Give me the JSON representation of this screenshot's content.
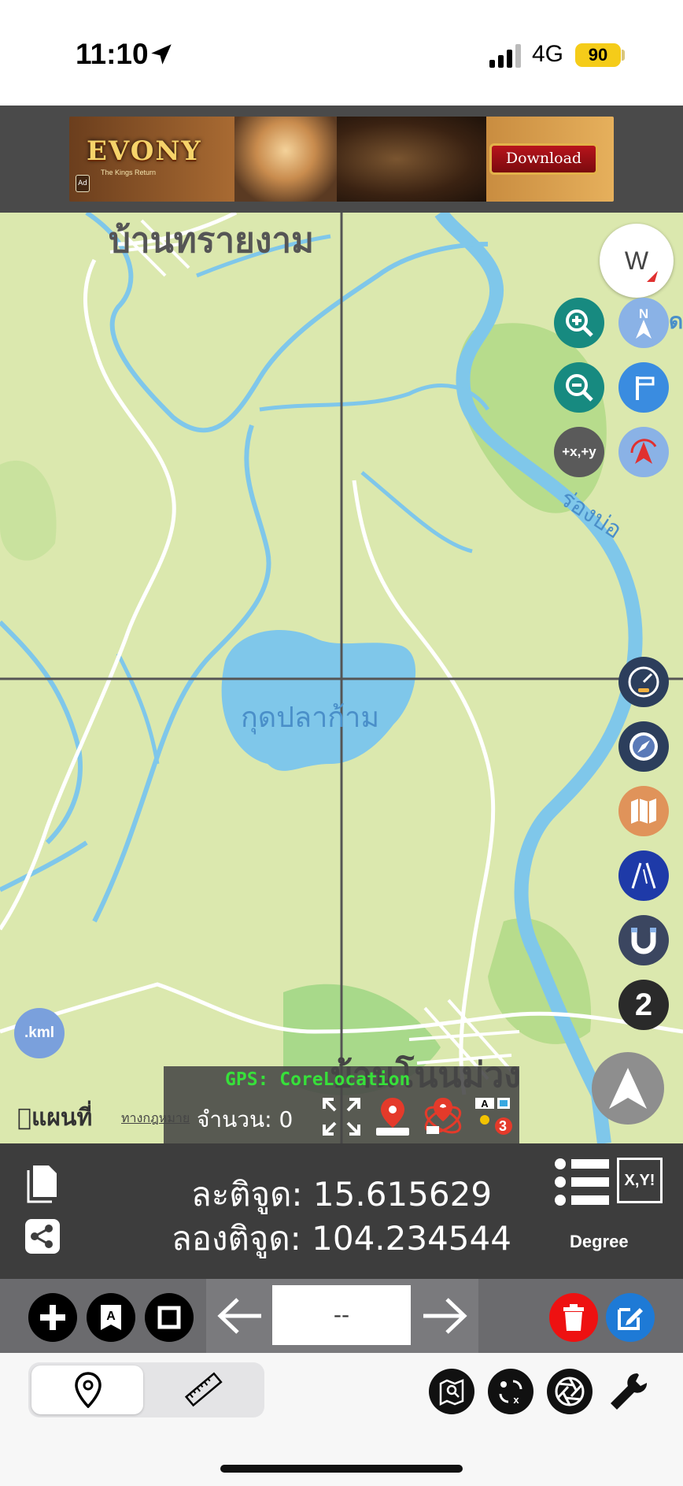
{
  "status": {
    "time": "11:10",
    "network": "4G",
    "battery": "90"
  },
  "ad": {
    "logo": "EVONY",
    "tagline": "The Kings Return",
    "badge": "Ad",
    "download": "Download"
  },
  "map": {
    "labels": {
      "north_village": "บ้านทรายงาม",
      "lake": "กุดปลาก้าม",
      "south_village": "บ้านโนนม่วง",
      "river": "ร่องบ่อ",
      "edge": "ด"
    },
    "compass_letter": "W",
    "xy_button": "+x,+y",
    "layer_number": "2",
    "kml": ".kml",
    "apple_maps": "แผนที่",
    "legal": "ทางกฎหมาย"
  },
  "gps": {
    "source": "GPS: CoreLocation",
    "count": "จำนวน: 0",
    "badge_count": "3",
    "badge_a": "A"
  },
  "coords": {
    "lat": "ละติจูด: 15.615629",
    "lon": "ลองติจูด: 104.234544",
    "xy_label": "X,Y!",
    "unit": "Degree"
  },
  "toolbar": {
    "page_value": "--"
  },
  "colors": {
    "water": "#7fc7ea",
    "land": "#dbe8ae",
    "teal": "#178a80",
    "panel": "#3d3d3d",
    "delete": "#ee1111",
    "edit": "#1e7ad6"
  }
}
